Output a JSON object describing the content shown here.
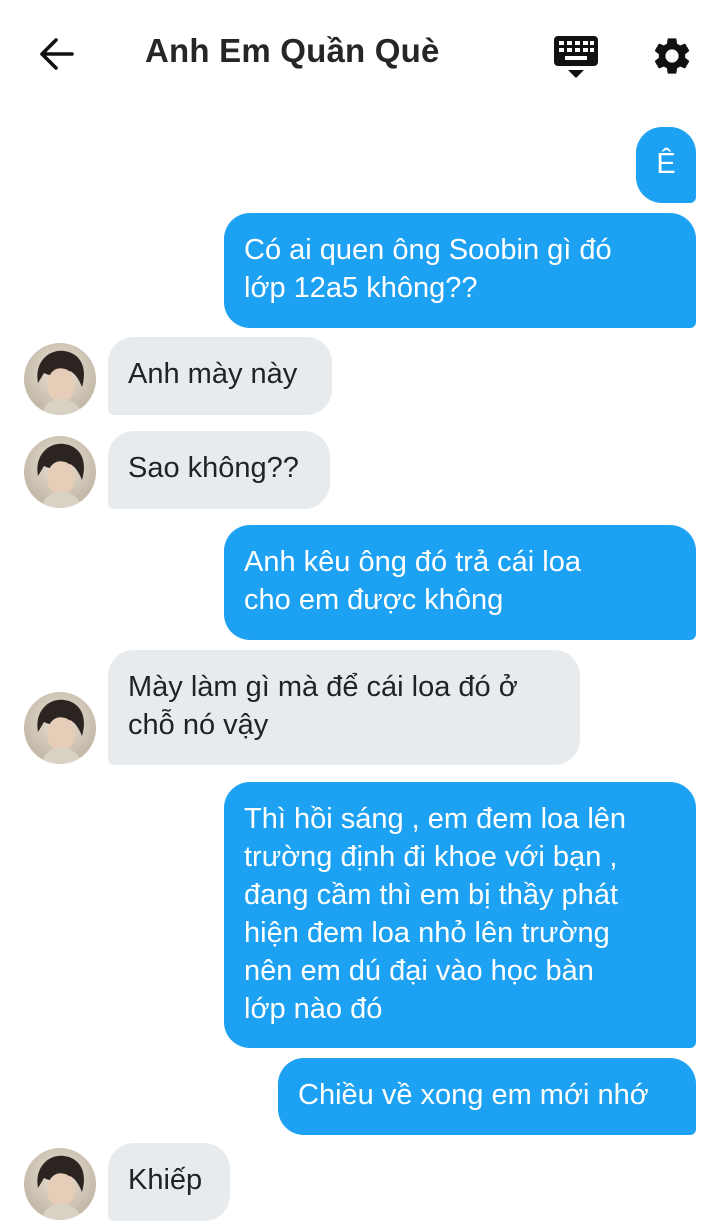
{
  "header": {
    "title": "Anh Em Quần Què",
    "back_icon": "arrow-left-icon",
    "keyboard_icon": "keyboard-icon",
    "settings_icon": "gear-icon"
  },
  "colors": {
    "outgoing_bubble": "#1da1f2",
    "incoming_bubble": "#e8ebee"
  },
  "messages": [
    {
      "direction": "out",
      "lines": [
        "Ê"
      ]
    },
    {
      "direction": "out",
      "lines": [
        "Có ai quen ông Soobin gì đó",
        "lớp 12a5 không??"
      ]
    },
    {
      "direction": "in",
      "lines": [
        "Anh mày này"
      ]
    },
    {
      "direction": "in",
      "lines": [
        "Sao không??"
      ]
    },
    {
      "direction": "out",
      "lines": [
        "Anh kêu ông đó trả cái loa",
        "cho em được không"
      ]
    },
    {
      "direction": "in",
      "lines": [
        "Mày làm gì mà để cái loa đó ở",
        "chỗ nó vậy"
      ]
    },
    {
      "direction": "out",
      "lines": [
        "Thì hồi sáng , em đem loa lên",
        "trường định đi khoe với bạn ,",
        "đang cầm thì em bị thầy phát",
        "hiện đem loa nhỏ lên trường",
        "nên em dú đại vào học bàn",
        "lớp nào đó"
      ]
    },
    {
      "direction": "out",
      "lines": [
        "Chiều về xong em mới nhớ"
      ]
    },
    {
      "direction": "in",
      "lines": [
        "Khiếp"
      ]
    }
  ]
}
